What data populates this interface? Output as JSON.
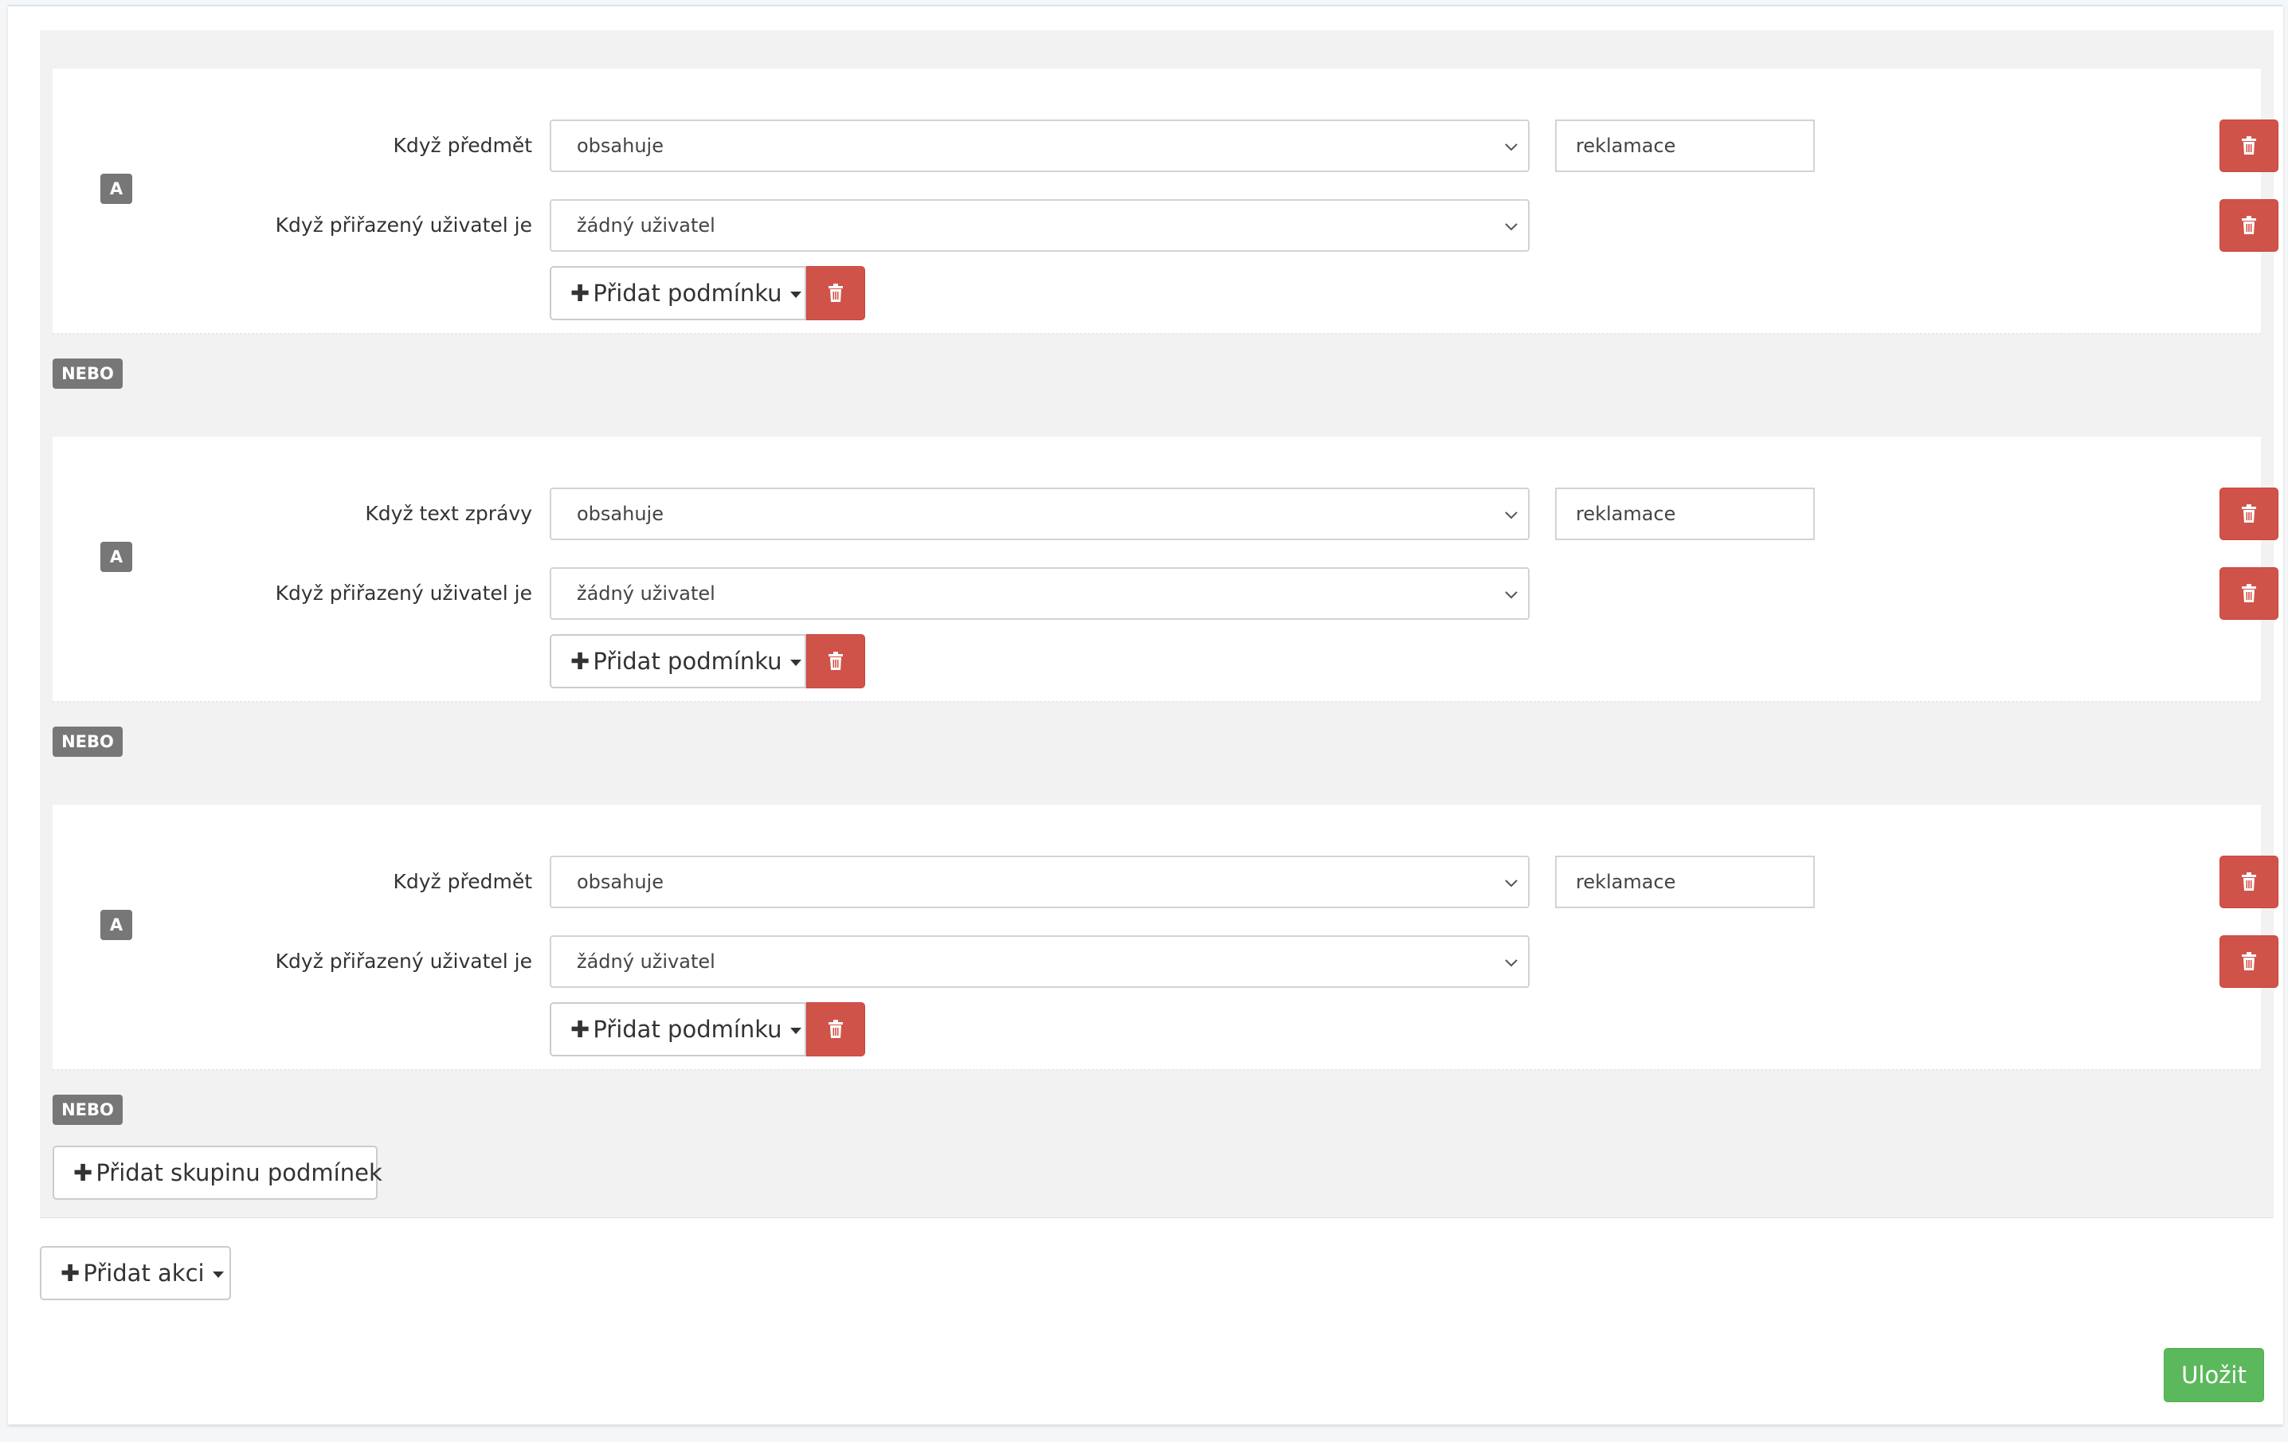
{
  "groups": [
    {
      "and_label": "A",
      "conditions": [
        {
          "label": "Když předmět",
          "operator": "obsahuje",
          "value": "reklamace"
        },
        {
          "label": "Když přiřazený uživatel je",
          "operator": "žádný uživatel"
        }
      ],
      "add_condition_label": "Přidat podmínku",
      "or_label": "NEBO"
    },
    {
      "and_label": "A",
      "conditions": [
        {
          "label": "Když text zprávy",
          "operator": "obsahuje",
          "value": "reklamace"
        },
        {
          "label": "Když přiřazený uživatel je",
          "operator": "žádný uživatel"
        }
      ],
      "add_condition_label": "Přidat podmínku",
      "or_label": "NEBO"
    },
    {
      "and_label": "A",
      "conditions": [
        {
          "label": "Když předmět",
          "operator": "obsahuje",
          "value": "reklamace"
        },
        {
          "label": "Když přiřazený uživatel je",
          "operator": "žádný uživatel"
        }
      ],
      "add_condition_label": "Přidat podmínku",
      "or_label": "NEBO"
    }
  ],
  "add_group_label": "Přidat skupinu podmínek",
  "add_action_label": "Přidat akci",
  "save_label": "Uložit",
  "icons": {
    "delete": "trash-icon",
    "add": "plus-icon",
    "dropdown": "chevron-down-icon",
    "menu": "caret-down-icon"
  },
  "colors": {
    "danger": "#d0534a",
    "success": "#5cb85c",
    "badge": "#777777"
  }
}
